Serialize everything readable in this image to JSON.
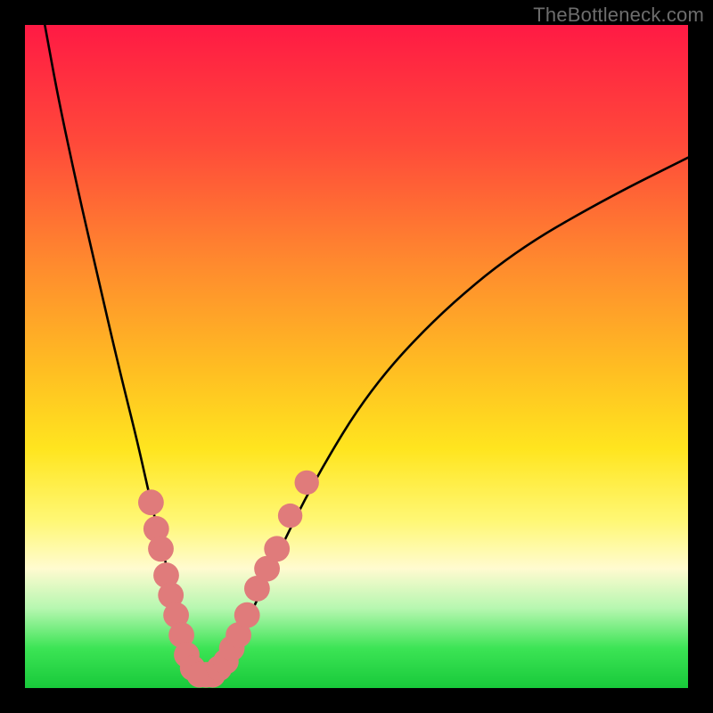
{
  "watermark": "TheBottleneck.com",
  "colors": {
    "frame": "#000000",
    "curve_stroke": "#000000",
    "marker_fill": "#e07b7b",
    "gradient_top": "#ff1a44",
    "gradient_bottom": "#18c93a"
  },
  "chart_data": {
    "type": "line",
    "title": "",
    "xlabel": "",
    "ylabel": "",
    "xlim": [
      0,
      100
    ],
    "ylim": [
      0,
      100
    ],
    "grid": false,
    "series": [
      {
        "name": "bottleneck-curve",
        "x": [
          3,
          5,
          8,
          11,
          14,
          17,
          19,
          21,
          22.5,
          24,
          25.5,
          27,
          29,
          31,
          34,
          38,
          44,
          52,
          62,
          74,
          88,
          100
        ],
        "y": [
          100,
          89,
          75,
          62,
          49,
          37,
          28,
          20,
          13,
          7,
          3,
          2,
          2,
          5,
          11,
          20,
          32,
          45,
          56,
          66,
          74,
          80
        ]
      }
    ],
    "markers": [
      {
        "x": 19.0,
        "y": 28,
        "r": 1.4
      },
      {
        "x": 19.8,
        "y": 24,
        "r": 1.4
      },
      {
        "x": 20.5,
        "y": 21,
        "r": 1.4
      },
      {
        "x": 21.3,
        "y": 17,
        "r": 1.4
      },
      {
        "x": 22.0,
        "y": 14,
        "r": 1.4
      },
      {
        "x": 22.8,
        "y": 11,
        "r": 1.4
      },
      {
        "x": 23.6,
        "y": 8,
        "r": 1.4
      },
      {
        "x": 24.4,
        "y": 5,
        "r": 1.4
      },
      {
        "x": 25.3,
        "y": 3,
        "r": 1.4
      },
      {
        "x": 26.3,
        "y": 2,
        "r": 1.4
      },
      {
        "x": 27.3,
        "y": 2,
        "r": 1.4
      },
      {
        "x": 28.3,
        "y": 2,
        "r": 1.4
      },
      {
        "x": 29.3,
        "y": 3,
        "r": 1.4
      },
      {
        "x": 30.3,
        "y": 4,
        "r": 1.4
      },
      {
        "x": 31.2,
        "y": 6,
        "r": 1.4
      },
      {
        "x": 32.2,
        "y": 8,
        "r": 1.4
      },
      {
        "x": 33.5,
        "y": 11,
        "r": 1.4
      },
      {
        "x": 35.0,
        "y": 15,
        "r": 1.4
      },
      {
        "x": 36.5,
        "y": 18,
        "r": 1.4
      },
      {
        "x": 38.0,
        "y": 21,
        "r": 1.4
      },
      {
        "x": 40.0,
        "y": 26,
        "r": 1.3
      },
      {
        "x": 42.5,
        "y": 31,
        "r": 1.3
      }
    ]
  }
}
